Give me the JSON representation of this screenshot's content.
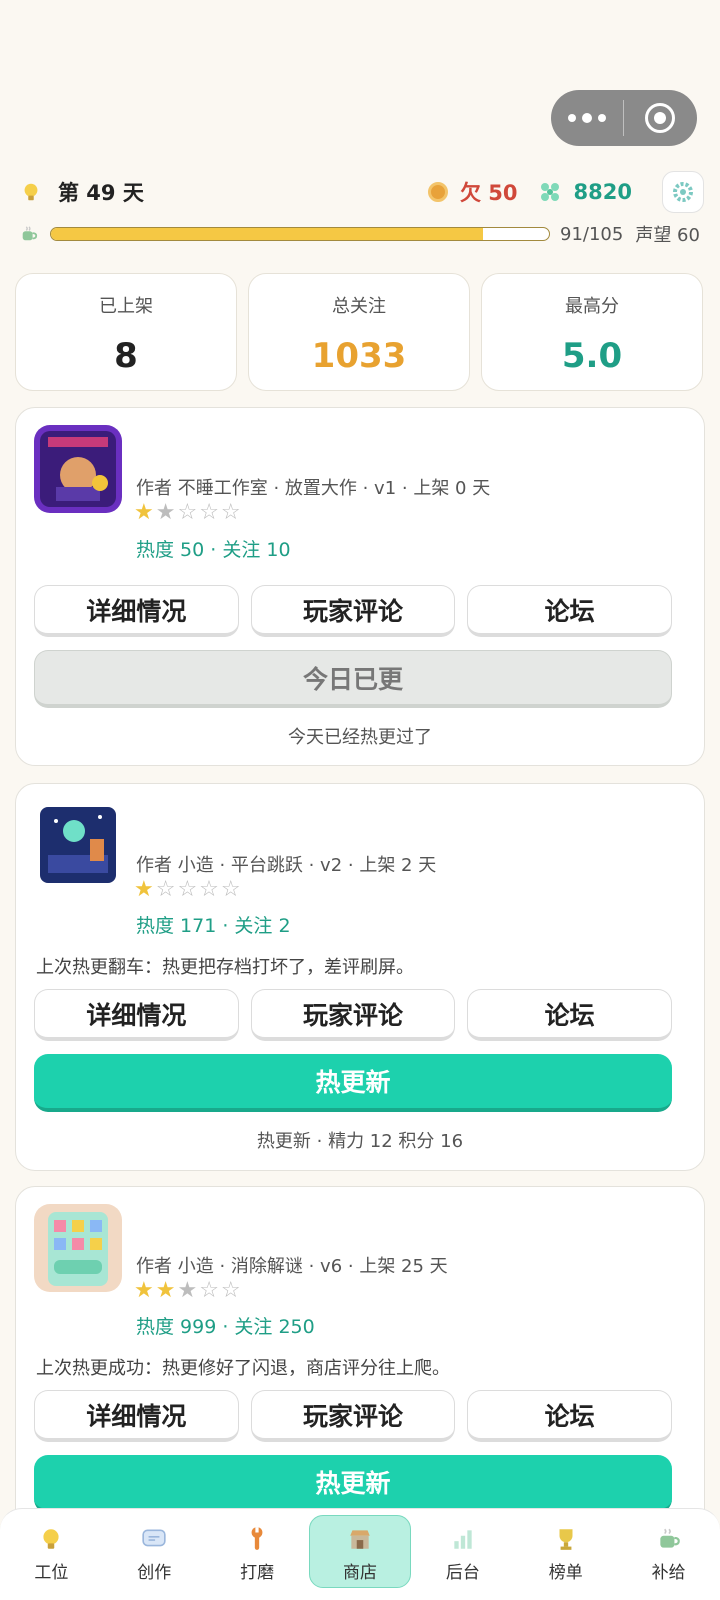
{
  "header": {
    "day_label": "第 49 天",
    "debt_label": "欠 50",
    "gems_label": "8820",
    "progress": {
      "value": 91,
      "max": 105,
      "text": "91/105"
    },
    "reputation_label": "声望 60"
  },
  "stats": [
    {
      "label": "已上架",
      "value": "8",
      "color": "#222222"
    },
    {
      "label": "总关注",
      "value": "1033",
      "color": "#e8a230"
    },
    {
      "label": "最高分",
      "value": "5.0",
      "color": "#1f9e86"
    }
  ],
  "games": [
    {
      "meta": "作者 不睡工作室  ·  放置大作 · v1 · 上架 0 天",
      "stars": "★★☆☆☆",
      "heat": "热度 50  ·  关注 10",
      "note": "",
      "buttons": [
        "详细情况",
        "玩家评论",
        "论坛"
      ],
      "action": "今日已更",
      "sub": "今天已经热更过了"
    },
    {
      "meta": "作者 小造  ·  平台跳跃 · v2 · 上架 2 天",
      "stars": "★☆☆☆☆",
      "heat": "热度 171  ·  关注 2",
      "note": "上次热更翻车：热更把存档打坏了，差评刷屏。",
      "buttons": [
        "详细情况",
        "玩家评论",
        "论坛"
      ],
      "action": "热更新",
      "sub": "热更新  ·  精力 12  积分 16"
    },
    {
      "meta": "作者 小造  ·  消除解谜 · v6 · 上架 25 天",
      "stars": "★★★☆☆",
      "heat": "热度 999  ·  关注 250",
      "note": "上次热更成功：热更修好了闪退，商店评分往上爬。",
      "buttons": [
        "详细情况",
        "玩家评论",
        "论坛"
      ],
      "action": "热更新",
      "sub": ""
    }
  ],
  "nav": [
    {
      "label": "工位",
      "icon": "bulb-icon"
    },
    {
      "label": "创作",
      "icon": "chat-icon"
    },
    {
      "label": "打磨",
      "icon": "wrench-icon"
    },
    {
      "label": "商店",
      "icon": "store-icon"
    },
    {
      "label": "后台",
      "icon": "chart-icon"
    },
    {
      "label": "榜单",
      "icon": "trophy-icon"
    },
    {
      "label": "补给",
      "icon": "cup-icon"
    }
  ],
  "colors": {
    "accent": "#1dd1ad",
    "gem": "#1f9e86",
    "debt": "#d0483a",
    "gold": "#f0c33c"
  }
}
